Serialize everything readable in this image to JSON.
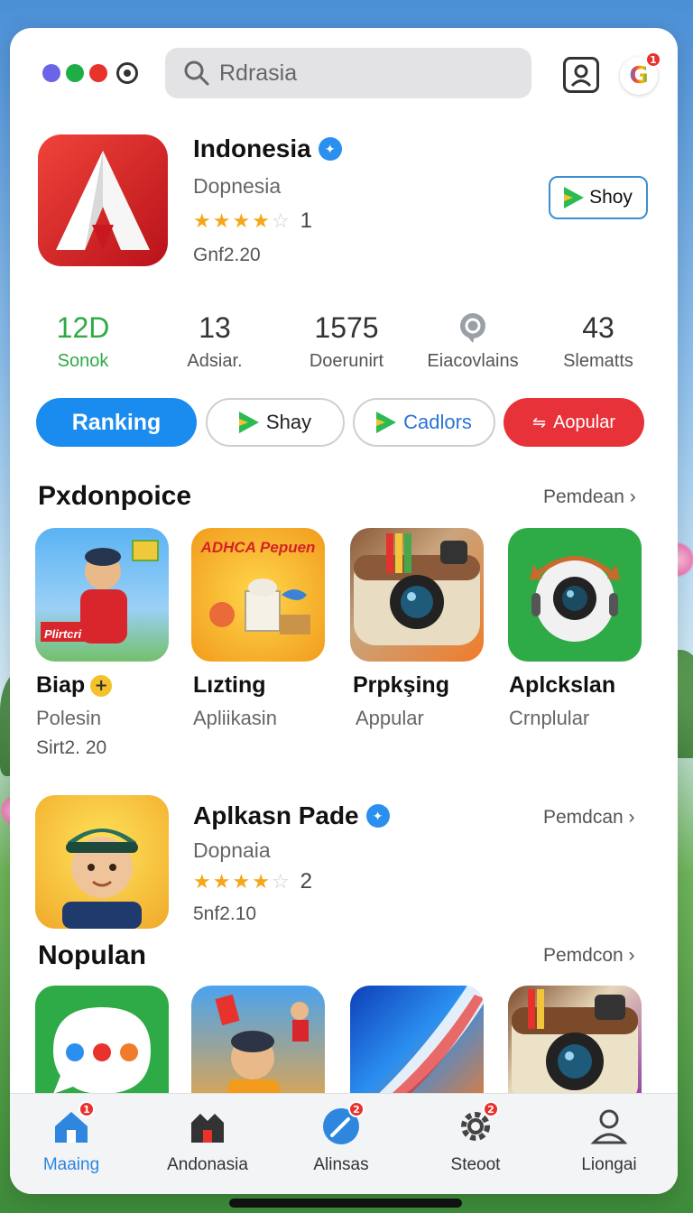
{
  "search": {
    "value": "Rdrasia"
  },
  "hero": {
    "title": "Indonesia",
    "subtitle": "Dopnesia",
    "rating_count": "1",
    "meta": "Gnf2.20",
    "button_label": "Shoy"
  },
  "stats": [
    {
      "value": "12D",
      "label": "Sonok"
    },
    {
      "value": "13",
      "label": "Adsiar."
    },
    {
      "value": "1575",
      "label": "Doerunirt"
    },
    {
      "value": "",
      "label": "Eiacovlains"
    },
    {
      "value": "43",
      "label": "Slematts"
    }
  ],
  "pills": {
    "ranking": "Ranking",
    "shay": "Shay",
    "cadlors": "Cadlors",
    "aopular": "Aopular"
  },
  "section1": {
    "title": "Pxdonpoice",
    "more": "Pemdean",
    "apps": [
      {
        "name": "Biap",
        "sub": "Polesin",
        "meta": "Sirt2. 20",
        "tile_text": "Plirtcri"
      },
      {
        "name": "Lızting",
        "sub": "Apliikasin",
        "tile_text": "ADHCA Pepuen"
      },
      {
        "name": "Prpkşing",
        "sub": "Appular"
      },
      {
        "name": "Aplckslan",
        "sub": "Crnplular"
      }
    ]
  },
  "featured": {
    "title": "Aplkasn Pade",
    "subtitle": "Dopnaia",
    "rating_count": "2",
    "meta": "5nf2.10",
    "more": "Pemdcan"
  },
  "section2": {
    "title": "Nopulan",
    "more": "Pemdcon"
  },
  "nav": [
    {
      "label": "Maaing",
      "badge": "1"
    },
    {
      "label": "Andonasia",
      "badge": ""
    },
    {
      "label": "Alinsas",
      "badge": "2"
    },
    {
      "label": "Steoot",
      "badge": "2"
    },
    {
      "label": "Liongai",
      "badge": ""
    }
  ],
  "badges": {
    "google": "1"
  },
  "colors": {
    "primary": "#1a8cf0",
    "red": "#e8323a",
    "green": "#2eaa46",
    "star": "#f4a71a"
  }
}
